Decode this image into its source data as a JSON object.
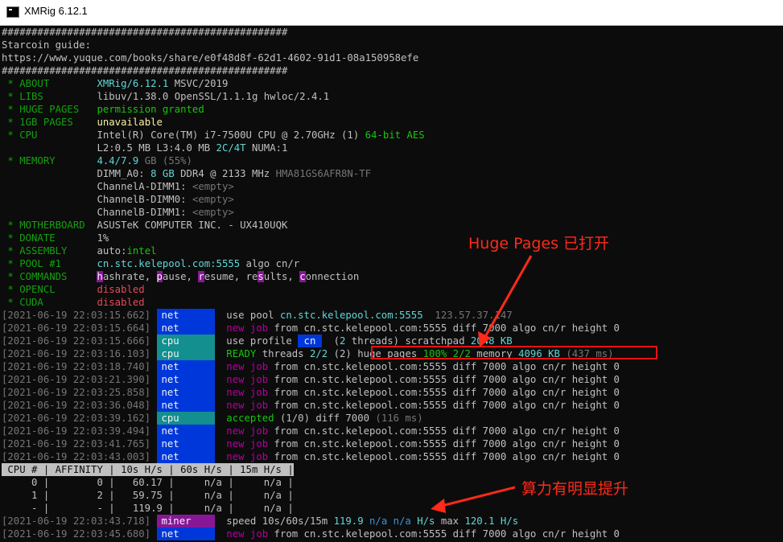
{
  "window": {
    "title": "XMRig 6.12.1"
  },
  "header": {
    "hash1": "################################################",
    "guide_label": "Starcoin guide:",
    "guide_url": "https://www.yuque.com/books/share/e0f48d8f-62d1-4602-91d1-08a150958efe",
    "hash2": "################################################"
  },
  "info": {
    "about_label": " * ABOUT        ",
    "about_val": "XMRig/6.12.1",
    "about_extra": " MSVC/2019",
    "libs_label": " * LIBS         ",
    "libs_val": "libuv/1.38.0 OpenSSL/1.1.1g hwloc/2.4.1",
    "huge_label": " * HUGE PAGES   ",
    "huge_val": "permission granted",
    "gb_label": " * 1GB PAGES    ",
    "gb_val": "unavailable",
    "cpu_label": " * CPU          ",
    "cpu_val": "Intel(R) Core(TM) i7-7500U CPU @ 2.70GHz (1) ",
    "cpu_ext": "64-bit AES",
    "cache_pad": "                ",
    "cache_val": "L2:0.5 MB L3:4.0 MB ",
    "cache_ct": "2C/4T",
    "cache_numa": " NUMA:1",
    "mem_label": " * MEMORY       ",
    "mem_val": "4.4/7.9",
    "mem_gb": " GB",
    "mem_pct": " (55%)",
    "dimm0_label": "DIMM_A0: ",
    "dimm0_gb": "8 GB",
    "dimm0_val": " DDR4 @ 2133 MHz ",
    "dimm0_part": "HMA81GS6AFR8N-TF",
    "dimm1": "ChannelA-DIMM1: ",
    "dimm2": "ChannelB-DIMM0: ",
    "dimm3": "ChannelB-DIMM1: ",
    "empty": "<empty>",
    "mb_label": " * MOTHERBOARD  ",
    "mb_val": "ASUSTeK COMPUTER INC. - UX410UQK",
    "donate_label": " * DONATE       ",
    "donate_val": "1%",
    "asm_label": " * ASSEMBLY     ",
    "asm_val": "auto:",
    "asm_val2": "intel",
    "pool_label": " * POOL #1      ",
    "pool_val": "cn.stc.kelepool.com:5555",
    "pool_algo": " algo cn/r",
    "cmd_label": " * COMMANDS     ",
    "cmd_h": "h",
    "cmd_h2": "ashrate, ",
    "cmd_p": "p",
    "cmd_p2": "ause, ",
    "cmd_r": "r",
    "cmd_r2": "esume, re",
    "cmd_s": "s",
    "cmd_s2": "ults, ",
    "cmd_c": "c",
    "cmd_c2": "onnection",
    "opencl_label": " * OPENCL       ",
    "opencl_val": "disabled",
    "cuda_label": " * CUDA         ",
    "cuda_val": "disabled"
  },
  "log": [
    {
      "ts": "[2021-06-19 22:03:15.662] ",
      "tag": "net"
    },
    {
      "ts": "[2021-06-19 22:03:15.664] ",
      "tag": "net"
    },
    {
      "ts": "[2021-06-19 22:03:15.666] ",
      "tag": "cpu"
    },
    {
      "ts": "[2021-06-19 22:03:16.103] ",
      "tag": "cpu"
    },
    {
      "ts": "[2021-06-19 22:03:18.740] ",
      "tag": "net"
    },
    {
      "ts": "[2021-06-19 22:03:21.390] ",
      "tag": "net"
    },
    {
      "ts": "[2021-06-19 22:03:25.858] ",
      "tag": "net"
    },
    {
      "ts": "[2021-06-19 22:03:36.048] ",
      "tag": "net"
    },
    {
      "ts": "[2021-06-19 22:03:39.162] ",
      "tag": "cpu"
    },
    {
      "ts": "[2021-06-19 22:03:39.494] ",
      "tag": "net"
    },
    {
      "ts": "[2021-06-19 22:03:41.765] ",
      "tag": "net"
    },
    {
      "ts": "[2021-06-19 22:03:43.003] ",
      "tag": "net"
    },
    {
      "ts": "[2021-06-19 22:03:43.718] ",
      "tag": "miner"
    },
    {
      "ts": "[2021-06-19 22:03:45.680] ",
      "tag": "net"
    }
  ],
  "msg": {
    "use_pool": "  use pool ",
    "pool_host": "cn.stc.kelepool.com:5555",
    "pool_ip": "  123.57.37.147",
    "new_job": "  new job",
    "from": " from cn.stc.kelepool.com:5555 diff 7000 algo cn/r height 0",
    "use_profile": "  use profile ",
    "profile": " cn ",
    "threads_pre": "  (",
    "threads_n": "2",
    "threads_post": " threads) scratchpad ",
    "scratch": "2048 KB",
    "ready": "  READY",
    "ready_threads": " threads ",
    "ready_n": "2/2",
    "ready_paren": " (2) ",
    "hp": "huge pages ",
    "hp_val": "100% 2/2",
    "hp_mem": " memory ",
    "hp_kb": "4096 KB",
    "hp_ms": " (437 ms)",
    "accepted": "  accepted",
    "acc_count": " (1/0)",
    "acc_diff": " diff 7000",
    "acc_ms": " (116 ms)",
    "speed": "  speed 10s/60s/15m ",
    "speed_v": "119.9",
    "speed_na": " n/a n/a",
    "speed_unit": " H/s",
    "speed_max": " max ",
    "speed_max_v": "120.1 H/s"
  },
  "table": {
    "header": " CPU # | AFFINITY | 10s H/s | 60s H/s | 15m H/s |",
    "rows": [
      "     0 |        0 |   60.17 |     n/a |     n/a |",
      "     1 |        2 |   59.75 |     n/a |     n/a |",
      "     - |        - |   119.9 |     n/a |     n/a |"
    ]
  },
  "annotations": {
    "huge_pages_note": "Huge Pages 已打开",
    "hashrate_note": "算力有明显提升",
    "color": "#ff2a1a"
  }
}
